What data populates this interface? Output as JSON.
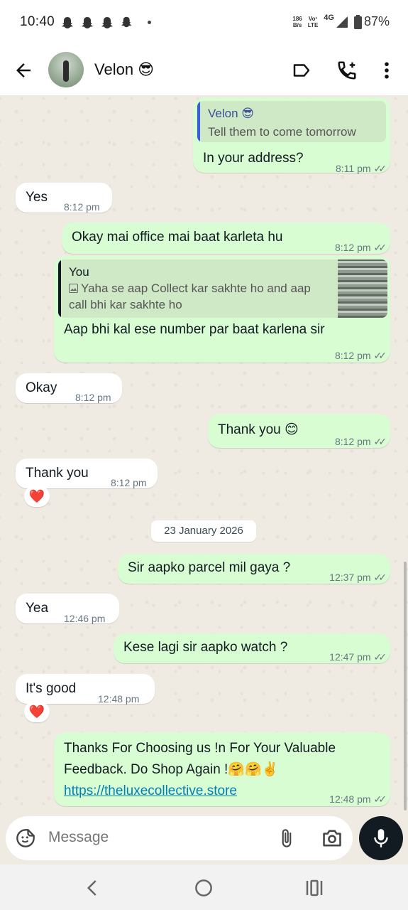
{
  "status": {
    "time": "10:40",
    "notif_icons": "ghost-icon x4",
    "speed_top": "186",
    "speed_bottom": "B/s",
    "net_top": "Vo¹",
    "net_bottom": "LTE",
    "network": "4G",
    "battery": "87%"
  },
  "header": {
    "contact_name": "Velon 😎"
  },
  "messages": [
    {
      "dir": "out",
      "quote_name": "Velon 😎",
      "quote_text": "Tell them to come tomorrow",
      "text": "In your address?",
      "time": "8:11 pm"
    },
    {
      "dir": "in",
      "text": "Yes",
      "time": "8:12 pm"
    },
    {
      "dir": "out",
      "text": "Okay mai office mai baat karleta hu",
      "time": "8:12 pm"
    },
    {
      "dir": "out",
      "quote_name": "You",
      "quote_text": "Yaha se aap Collect kar sakhte ho and aap call bhi kar sakhte ho",
      "text": "Aap bhi kal ese number par baat karlena sir",
      "time": "8:12 pm"
    },
    {
      "dir": "in",
      "text": "Okay",
      "time": "8:12 pm"
    },
    {
      "dir": "out",
      "text": "Thank you 😊",
      "time": "8:12 pm"
    },
    {
      "dir": "in",
      "text": "Thank you",
      "time": "8:12 pm",
      "reaction": "❤️"
    },
    {
      "dir": "out",
      "text": "Sir aapko parcel mil gaya ?",
      "time": "12:37 pm"
    },
    {
      "dir": "in",
      "text": "Yea",
      "time": "12:46 pm"
    },
    {
      "dir": "out",
      "text": "Kese lagi sir aapko watch ?",
      "time": "12:47 pm"
    },
    {
      "dir": "in",
      "text": "It's good",
      "time": "12:48 pm",
      "reaction": "❤️"
    },
    {
      "dir": "out",
      "text_line1": "Thanks For Choosing us !n For Your Valuable",
      "text_line2": "Feedback. Do Shop Again !🤗🤗✌️",
      "link": "https://theluxecollective.store",
      "time": "12:48 pm"
    }
  ],
  "date_separator": "23 January 2026",
  "composer": {
    "placeholder": "Message"
  },
  "colors": {
    "outgoing": "#d9fdd3",
    "incoming": "#ffffff",
    "background": "#efeae2",
    "quote_accent_velon": "#3b5bdb",
    "quote_accent_you": "#111b21",
    "mic": "#111b21"
  }
}
